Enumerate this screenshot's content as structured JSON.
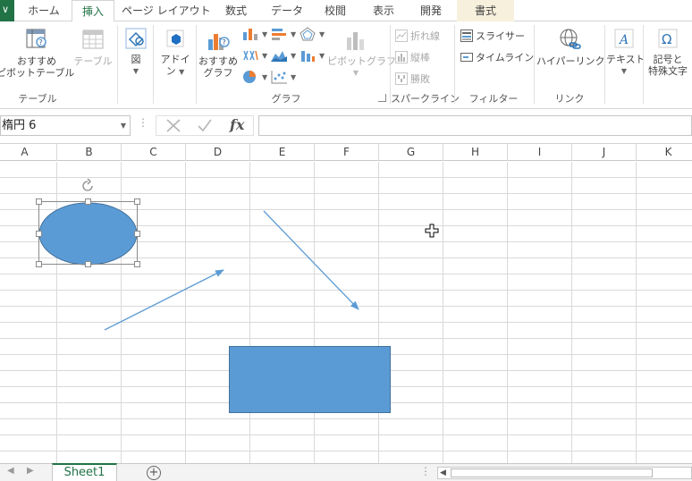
{
  "ribbon_tabs": [
    {
      "label": "ホーム"
    },
    {
      "label": "挿入"
    },
    {
      "label": "ページ レイアウト"
    },
    {
      "label": "数式"
    },
    {
      "label": "データ"
    },
    {
      "label": "校閲"
    },
    {
      "label": "表示"
    },
    {
      "label": "開発"
    },
    {
      "label": "書式"
    }
  ],
  "ribbon": {
    "pivot_recommended": {
      "line1": "おすすめ",
      "line2": "ピボットテーブル"
    },
    "table_btn": "テーブル",
    "group_table": "テーブル",
    "illustrations_btn": "図",
    "addin_btn": {
      "line1": "アドイ",
      "line2": "ン"
    },
    "recommended_chart": {
      "line1": "おすすめ",
      "line2": "グラフ"
    },
    "pivot_chart": "ピボットグラフ",
    "group_chart": "グラフ",
    "sparkline_line": "折れ線",
    "sparkline_column": "縦棒",
    "sparkline_winloss": "勝敗",
    "group_sparkline": "スパークライン",
    "slicer": "スライサー",
    "timeline": "タイムライン",
    "group_filter": "フィルター",
    "hyperlink": "ハイパーリンク",
    "group_link": "リンク",
    "text_btn": "テキスト",
    "symbols_btn": {
      "line1": "記号と",
      "line2": "特殊文字"
    }
  },
  "formula_bar": {
    "name_box": "楕円 6",
    "formula_value": "",
    "fx": "fx"
  },
  "columns": [
    "A",
    "B",
    "C",
    "D",
    "E",
    "F",
    "G",
    "H",
    "I",
    "J",
    "K"
  ],
  "sheets": [
    {
      "name": "Sheet1",
      "active": true
    }
  ],
  "colors": {
    "accent": "#217346",
    "shape_fill": "#5b9bd5",
    "shape_border": "#41719c",
    "grid_line": "#d9d9d9",
    "tab_context": "#f7f0dc"
  },
  "shapes": {
    "ellipse": {
      "name": "楕円 6",
      "selected": true
    },
    "rectangle": {
      "selected": false
    },
    "arrow1": {
      "selected": false
    },
    "arrow2": {
      "selected": false
    }
  }
}
